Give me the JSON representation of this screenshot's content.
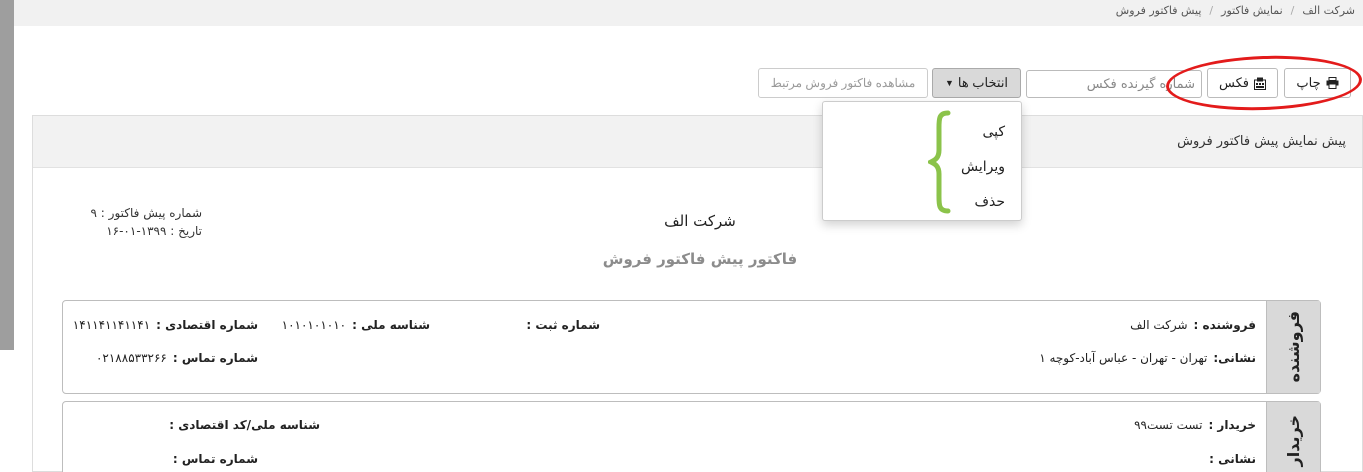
{
  "breadcrumb": [
    "شرکت الف",
    "نمایش فاکتور",
    "پیش فاکتور فروش"
  ],
  "toolbar": {
    "print_label": "چاپ",
    "fax_label": "فکس",
    "fax_number_placeholder": "شماره گیرنده فکس",
    "select_label": "انتخاب ها",
    "related_label": "مشاهده فاکتور فروش مرتبط"
  },
  "dropdown": {
    "items": [
      "کپی",
      "ویرایش",
      "حذف"
    ]
  },
  "panel": {
    "header": "پیش نمایش پیش فاکتور فروش"
  },
  "invoice": {
    "number_line": "شماره پیش فاکتور : ۹",
    "date_line": "تاریخ : ۱۳۹۹-۰۱-۱۶",
    "company": "شرکت الف",
    "title": "فاکتور پیش فاکتور فروش"
  },
  "seller": {
    "tab": "فروشنده",
    "name_label": "فروشنده :",
    "name_value": "شرکت الف",
    "reg_label": "شماره ثبت :",
    "national_label": "شناسه ملی :",
    "national_value": "۱۰۱۰۱۰۱۰۱۰",
    "economic_label": "شماره اقتصادی :",
    "economic_value": "۱۴۱۱۴۱۱۴۱۱۴۱",
    "address_label": "نشانی:",
    "address_value": "تهران - تهران - عباس آباد-کوچه ۱",
    "phone_label": "شماره تماس :",
    "phone_value": "۰۲۱۸۸۵۳۳۲۶۶"
  },
  "buyer": {
    "tab": "خریدار",
    "name_label": "خریدار :",
    "name_value": "تست تست۹۹",
    "national_label": "شناسه ملی/کد اقتصادی :",
    "address_label": "نشانی :",
    "phone_label": "شماره تماس :"
  },
  "colors": {
    "highlight_ring": "#e31b1b",
    "annotation_brace": "#8bc34a"
  }
}
